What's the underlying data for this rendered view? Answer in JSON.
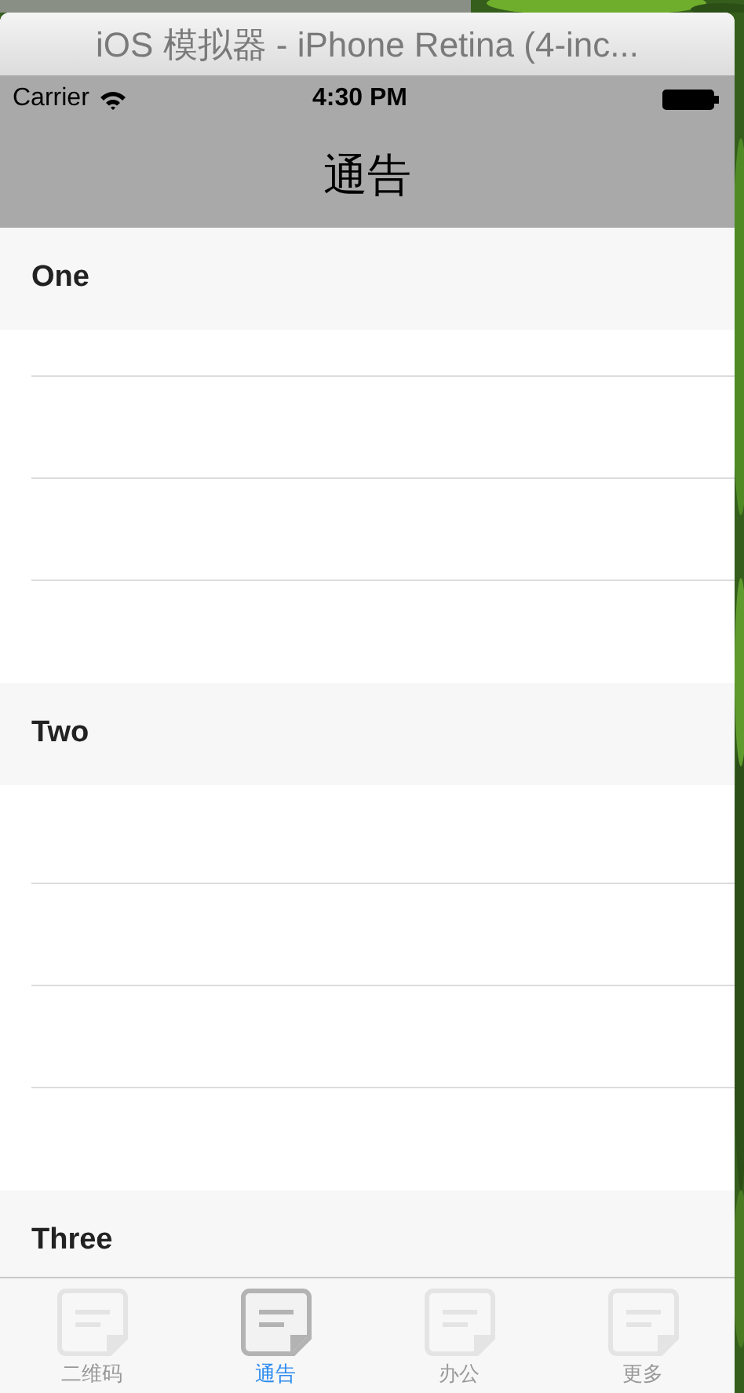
{
  "window": {
    "title": "iOS 模拟器 - iPhone Retina (4-inc..."
  },
  "status_bar": {
    "carrier": "Carrier",
    "time": "4:30 PM"
  },
  "nav_bar": {
    "title": "通告"
  },
  "sections": [
    {
      "title": "One"
    },
    {
      "title": "Two"
    },
    {
      "title": "Three"
    }
  ],
  "tab_bar": [
    {
      "label": "二维码",
      "selected": false
    },
    {
      "label": "通告",
      "selected": true
    },
    {
      "label": "办公",
      "selected": false
    },
    {
      "label": "更多",
      "selected": false
    }
  ]
}
